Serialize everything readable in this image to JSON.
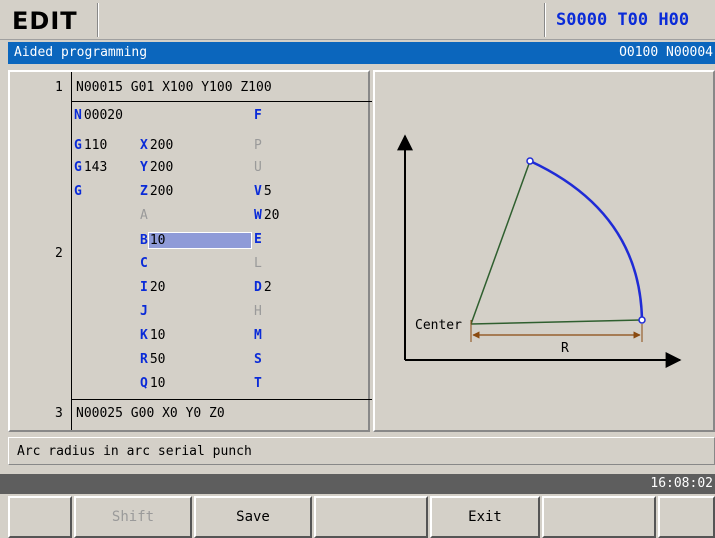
{
  "header": {
    "mode": "EDIT",
    "status": "S0000 T00 H00"
  },
  "titlebar": {
    "title": "Aided programming",
    "program": "O0100 N00004"
  },
  "program": {
    "line1_no": "1",
    "line1": "N00015 G01 X100 Y100 Z100",
    "line2_no": "2",
    "line3_no": "3",
    "line3": "N00025 G00 X0 Y0 Z0"
  },
  "fields": {
    "N": {
      "letter": "N",
      "value": "00020"
    },
    "G1": {
      "letter": "G",
      "value": "110"
    },
    "G2": {
      "letter": "G",
      "value": "143"
    },
    "G3": {
      "letter": "G",
      "value": ""
    },
    "X": {
      "letter": "X",
      "value": "200"
    },
    "Y": {
      "letter": "Y",
      "value": "200"
    },
    "Z": {
      "letter": "Z",
      "value": "200"
    },
    "A": {
      "letter": "A",
      "value": ""
    },
    "B": {
      "letter": "B",
      "value": "10"
    },
    "C": {
      "letter": "C",
      "value": ""
    },
    "I": {
      "letter": "I",
      "value": "20"
    },
    "J": {
      "letter": "J",
      "value": ""
    },
    "K": {
      "letter": "K",
      "value": "10"
    },
    "R": {
      "letter": "R",
      "value": "50"
    },
    "Q": {
      "letter": "Q",
      "value": "10"
    },
    "F": {
      "letter": "F",
      "value": ""
    },
    "P": {
      "letter": "P",
      "value": ""
    },
    "U": {
      "letter": "U",
      "value": ""
    },
    "V": {
      "letter": "V",
      "value": "5"
    },
    "W": {
      "letter": "W",
      "value": "20"
    },
    "E": {
      "letter": "E",
      "value": ""
    },
    "L": {
      "letter": "L",
      "value": ""
    },
    "D": {
      "letter": "D",
      "value": "2"
    },
    "H": {
      "letter": "H",
      "value": ""
    },
    "M": {
      "letter": "M",
      "value": ""
    },
    "S": {
      "letter": "S",
      "value": ""
    },
    "T": {
      "letter": "T",
      "value": ""
    }
  },
  "diagram": {
    "center_label": "Center",
    "radius_label": "R"
  },
  "hint": "Arc radius in arc serial punch",
  "clock": "16:08:02",
  "softkeys": [
    "",
    "Shift",
    "Save",
    "",
    "Exit",
    "",
    ""
  ],
  "colors": {
    "title_bar": "#0b66bd",
    "field_letter": "#0a2bd8",
    "arc": "#1f2bd6",
    "triangle": "#2f5f2f",
    "dimension": "#8a4a10"
  }
}
